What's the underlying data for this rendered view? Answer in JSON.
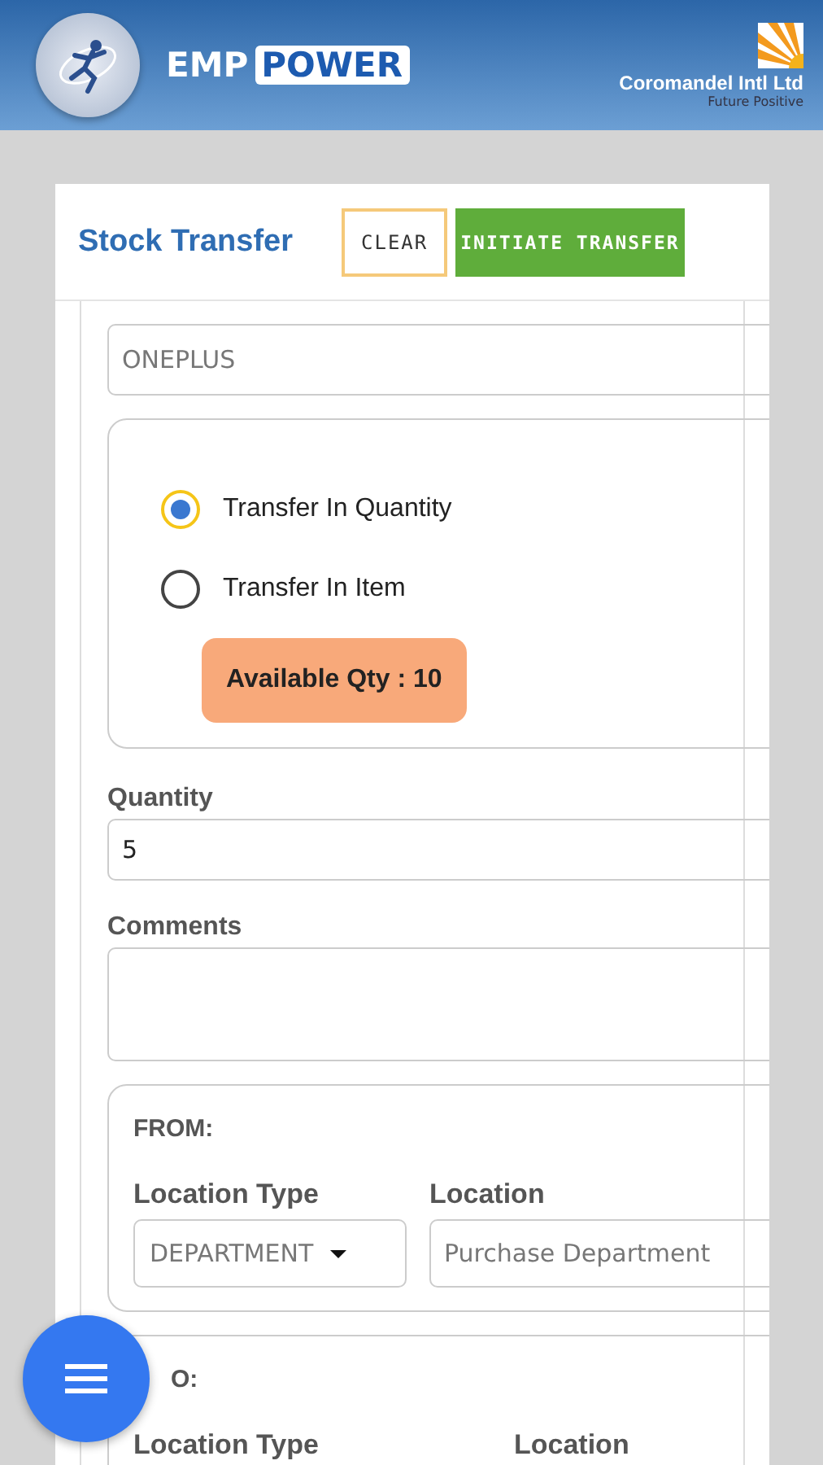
{
  "header": {
    "app_name_part1": "EMP",
    "app_name_part2": "POWER",
    "company": "Coromandel Intl Ltd",
    "tagline": "Future Positive"
  },
  "page": {
    "title": "Stock Transfer",
    "buttons": [
      {
        "label": "CLEAR",
        "kind": "outline"
      },
      {
        "label": "INITIATE TRANSFER",
        "kind": "primary"
      }
    ]
  },
  "asset": {
    "value": "ONEPLUS"
  },
  "transfer_mode": [
    {
      "label": "Transfer In Quantity",
      "selected": true
    },
    {
      "label": "Transfer In Item",
      "selected": false
    }
  ],
  "available_qty": "Available Qty : 10",
  "quantity": {
    "label": "Quantity",
    "value": "5"
  },
  "comments": {
    "label": "Comments"
  },
  "from": {
    "title": "FROM:",
    "location_type_label": "Location Type",
    "location_type": "DEPARTMENT",
    "location_label": "Location",
    "location": "Purchase Department"
  },
  "to": {
    "title": "O:",
    "location_type_label": "Location Type",
    "location_label": "Location"
  }
}
